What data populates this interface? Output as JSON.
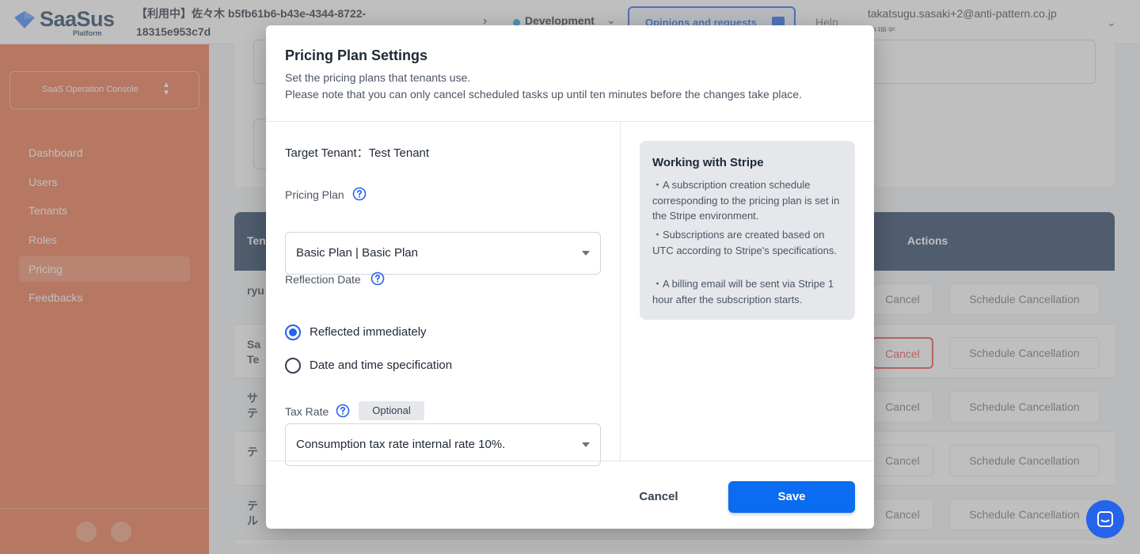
{
  "app": {
    "logo_text": "SaaSus",
    "logo_sub": "Platform",
    "env_title": "【利用中】佐々木 b5fb61b6-b43e-4344-8722-18315e953c7d",
    "env_name": "Development",
    "opinions_label": "Opinions and requests",
    "help_label": "Help",
    "user_email": "takatsugu.sasaki+2@anti-pattern.co.jp",
    "user_role": "管理者"
  },
  "sidebar": {
    "console_label": "SaaS Operation Console",
    "items": [
      {
        "label": "Dashboard"
      },
      {
        "label": "Users"
      },
      {
        "label": "Tenants"
      },
      {
        "label": "Roles"
      },
      {
        "label": "Pricing"
      },
      {
        "label": "Feedbacks"
      }
    ]
  },
  "table": {
    "col_first": "Ten",
    "col_actions": "Actions",
    "rows": [
      {
        "name": "ryu",
        "cancel": "Cancel",
        "schedule": "Schedule Cancellation"
      },
      {
        "name": "Sa\nTe",
        "cancel": "Cancel",
        "schedule": "Schedule Cancellation"
      },
      {
        "name": "サ\nテ",
        "cancel": "Cancel",
        "schedule": "Schedule Cancellation"
      },
      {
        "name": "テ",
        "cancel": "Cancel",
        "schedule": "Schedule Cancellation"
      },
      {
        "name": "テ\nル",
        "cancel": "Cancel",
        "schedule": "Schedule Cancellation"
      }
    ]
  },
  "modal": {
    "title": "Pricing Plan Settings",
    "desc_line1": "Set the pricing plans that tenants use.",
    "desc_line2": "Please note that you can only cancel scheduled tasks up until ten minutes before the changes take place.",
    "target_tenant": "Target Tenant：Test Tenant",
    "pricing_plan_label": "Pricing Plan",
    "pricing_plan_value": "Basic Plan | Basic Plan",
    "reflection_label": "Reflection Date",
    "radio_immediate": "Reflected immediately",
    "radio_datetime": "Date and time specification",
    "radio_selected": "immediate",
    "tax_label": "Tax Rate",
    "tax_badge": "Optional",
    "tax_value": "Consumption tax rate internal rate 10%.",
    "info_title": "Working with Stripe",
    "info_p1": "・A subscription creation schedule corresponding to the pricing plan is set in the Stripe environment.",
    "info_p2": "・Subscriptions are created based on UTC according to Stripe's specifications.",
    "info_p3": "・A billing email will be sent via Stripe 1 hour after the subscription starts.",
    "cancel_label": "Cancel",
    "save_label": "Save"
  },
  "colors": {
    "accent": "#0a6cf0",
    "sidebar": "#ed6f46",
    "header_dark": "#1e3a5f"
  }
}
